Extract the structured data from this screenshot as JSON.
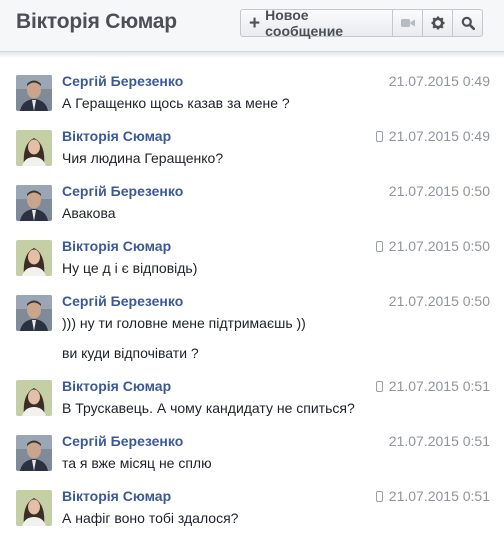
{
  "header": {
    "title": "Вікторія Сюмар",
    "new_message_label": "Новое сообщение"
  },
  "messages": [
    {
      "sender": "Сергій Березенко",
      "time": "21.07.2015 0:49",
      "mobile": false,
      "avatar": "man",
      "lines": [
        "А Геращенко щось казав за мене ?"
      ]
    },
    {
      "sender": "Вікторія Сюмар",
      "time": "21.07.2015 0:49",
      "mobile": true,
      "avatar": "woman",
      "lines": [
        "Чия людина Геращенко?"
      ]
    },
    {
      "sender": "Сергій Березенко",
      "time": "21.07.2015 0:50",
      "mobile": false,
      "avatar": "man",
      "lines": [
        "Авакова"
      ]
    },
    {
      "sender": "Вікторія Сюмар",
      "time": "21.07.2015 0:50",
      "mobile": true,
      "avatar": "woman",
      "lines": [
        "Ну це д і є відповідь)"
      ]
    },
    {
      "sender": "Сергій Березенко",
      "time": "21.07.2015 0:50",
      "mobile": false,
      "avatar": "man",
      "lines": [
        "))) ну ти головне мене підтримаєшь ))",
        "ви куди відпочівати ?"
      ]
    },
    {
      "sender": "Вікторія Сюмар",
      "time": "21.07.2015 0:51",
      "mobile": true,
      "avatar": "woman",
      "lines": [
        "В Трускавець. А чому кандидату не спиться?"
      ]
    },
    {
      "sender": "Сергій Березенко",
      "time": "21.07.2015 0:51",
      "mobile": false,
      "avatar": "man",
      "lines": [
        "та я вже місяц не сплю"
      ]
    },
    {
      "sender": "Вікторія Сюмар",
      "time": "21.07.2015 0:51",
      "mobile": true,
      "avatar": "woman",
      "lines": [
        "А нафіг воно тобі здалося?"
      ]
    }
  ]
}
